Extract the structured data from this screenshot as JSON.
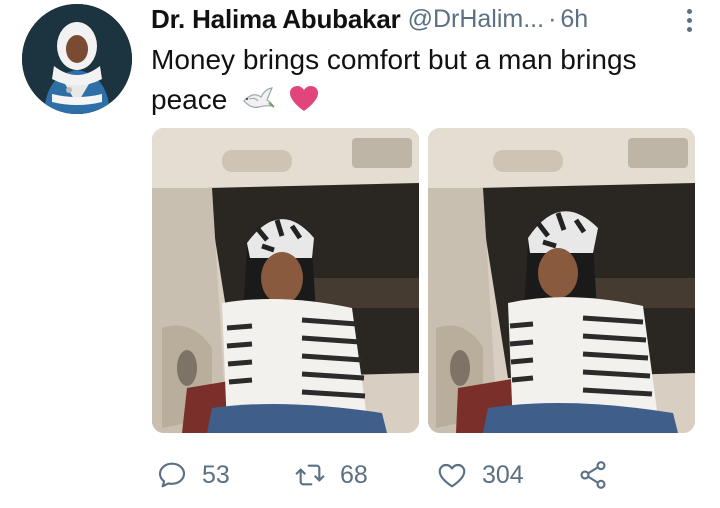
{
  "tweet": {
    "author_name": "Dr. Halima Abubakar",
    "handle": "@DrHalim...",
    "separator": "·",
    "time": "6h",
    "text": "Money brings comfort but a man brings peace",
    "emojis": [
      "dove-emoji",
      "pink-heart-emoji"
    ]
  },
  "actions": {
    "replies": "53",
    "retweets": "68",
    "likes": "304"
  },
  "colors": {
    "secondary_text": "#5b7083",
    "heart_emoji": "#e0457b"
  }
}
